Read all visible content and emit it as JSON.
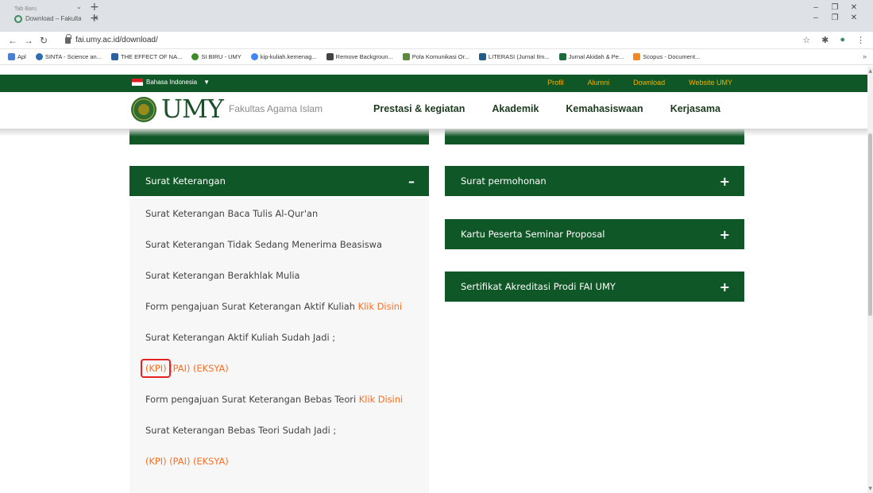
{
  "browser": {
    "tab_group_label": "Tab Baru",
    "tab_title": "Download – Fakultas Agama Islam",
    "url": "fai.umy.ac.id/download/",
    "bookmarks": [
      "Apl",
      "SINTA - Science an...",
      "THE EFFECT OF NA...",
      "SI BIRU - UMY",
      "kip-kuliah.kemenag...",
      "Remove Backgroun...",
      "Pola Komunikasi Or...",
      "LITERASI (Jurnal Ilm...",
      "Jurnal Akidah & Pe...",
      "Scopus - Document..."
    ],
    "more_bookmarks": "»"
  },
  "topbar": {
    "language": "Bahasa Indonesia",
    "links": [
      "Profil",
      "Alumni",
      "Download",
      "Website UMY"
    ]
  },
  "header": {
    "logo_text": "UMY",
    "faculty": "Fakultas Agama Islam",
    "menu": [
      "Prestasi & kegiatan",
      "Akademik",
      "Kemahasiswaan",
      "Kerjasama"
    ]
  },
  "left_accordion": {
    "title": "Surat Keterangan",
    "sign": "–",
    "items": [
      {
        "text": "Surat Keterangan Baca Tulis Al-Qur'an"
      },
      {
        "text": "Surat Keterangan Tidak Sedang Menerima Beasiswa"
      },
      {
        "text": "Surat Keterangan Berakhlak Mulia"
      },
      {
        "text": "Form pengajuan Surat Keterangan Aktif Kuliah",
        "link": "Klik Disini"
      },
      {
        "text": "Surat Keterangan Aktif Kuliah Sudah Jadi ;"
      },
      {
        "links": [
          "(KPI)",
          "(PAI)",
          "(EKSYA)"
        ]
      },
      {
        "text": "Form pengajuan Surat Keterangan Bebas Teori",
        "link": "Klik Disini"
      },
      {
        "text": "Surat Keterangan Bebas Teori Sudah Jadi ;"
      },
      {
        "links": [
          "(KPI)",
          "(PAI)",
          "(EKSYA)"
        ]
      }
    ]
  },
  "right_accordions": [
    {
      "title": "Surat permohonan",
      "sign": "+"
    },
    {
      "title": "Kartu Peserta Seminar Proposal",
      "sign": "+"
    },
    {
      "title": "Sertifikat Akreditasi Prodi FAI UMY",
      "sign": "+"
    }
  ],
  "colors": {
    "brand_green": "#0f5726",
    "link_orange": "#ff6d1f",
    "topbar_link_gold": "#f0b000",
    "highlight_red": "#e52222"
  }
}
